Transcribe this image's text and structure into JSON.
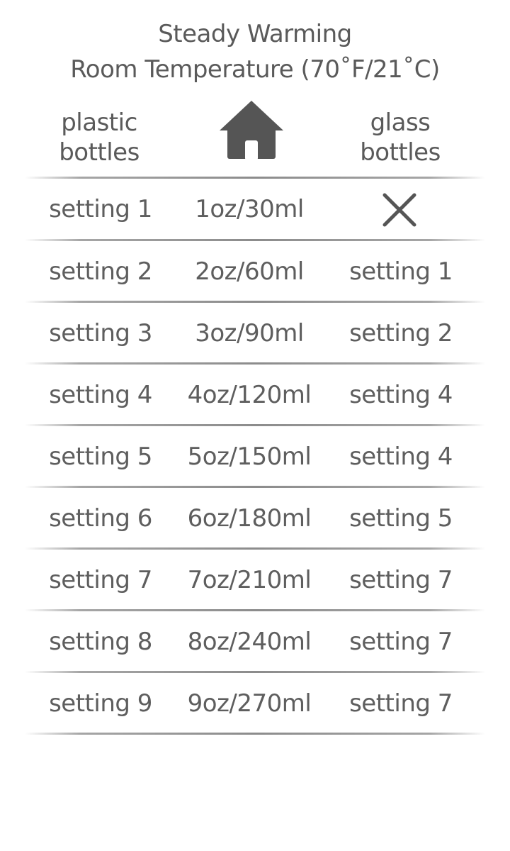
{
  "title": {
    "line1": "Steady Warming",
    "line2": "Room Temperature (70˚F/21˚C)"
  },
  "headers": {
    "left_line1": "plastic",
    "left_line2": "bottles",
    "center_icon": "house-icon",
    "right_line1": "glass",
    "right_line2": "bottles"
  },
  "rows": [
    {
      "plastic": "setting 1",
      "volume": "1oz/30ml",
      "glass": "",
      "glass_icon": "x-icon"
    },
    {
      "plastic": "setting 2",
      "volume": "2oz/60ml",
      "glass": "setting 1"
    },
    {
      "plastic": "setting 3",
      "volume": "3oz/90ml",
      "glass": "setting 2"
    },
    {
      "plastic": "setting 4",
      "volume": "4oz/120ml",
      "glass": "setting 4"
    },
    {
      "plastic": "setting 5",
      "volume": "5oz/150ml",
      "glass": "setting 4"
    },
    {
      "plastic": "setting 6",
      "volume": "6oz/180ml",
      "glass": "setting 5"
    },
    {
      "plastic": "setting 7",
      "volume": "7oz/210ml",
      "glass": "setting 7"
    },
    {
      "plastic": "setting 8",
      "volume": "8oz/240ml",
      "glass": "setting 7"
    },
    {
      "plastic": "setting 9",
      "volume": "9oz/270ml",
      "glass": "setting 7"
    }
  ],
  "colors": {
    "text": "#5e5e5e",
    "icon": "#555555",
    "rule": "#8c8c8c",
    "background": "#ffffff"
  }
}
